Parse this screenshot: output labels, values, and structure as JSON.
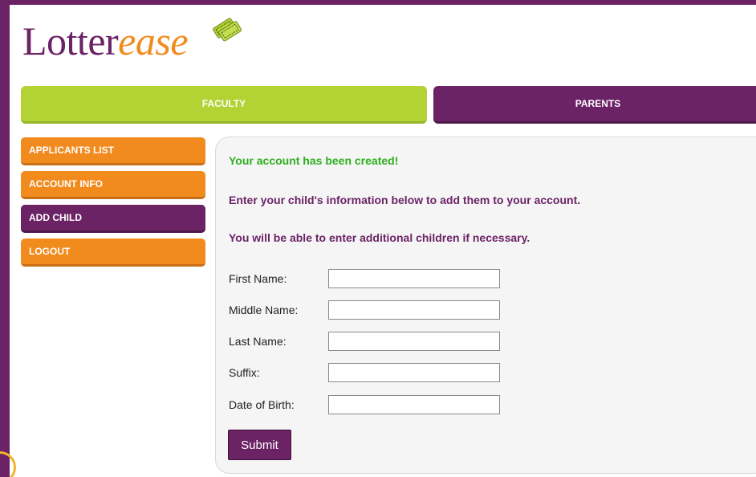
{
  "brand": {
    "name_part1": "Lotter",
    "name_part2": "ease",
    "primary_color": "#6b2366",
    "accent_color": "#f28b1e",
    "tab_green": "#b3d234"
  },
  "tabs": [
    {
      "label": "FACULTY",
      "active": false
    },
    {
      "label": "PARENTS",
      "active": true
    }
  ],
  "sidebar": {
    "items": [
      {
        "label": "APPLICANTS LIST",
        "active": false
      },
      {
        "label": "ACCOUNT INFO",
        "active": false
      },
      {
        "label": "ADD CHILD",
        "active": true
      },
      {
        "label": "LOGOUT",
        "active": false
      }
    ]
  },
  "main": {
    "success_message": "Your account has been created!",
    "instruction": "Enter your child's information below to add them to your account.",
    "note": "You will be able to enter additional children if necessary.",
    "fields": [
      {
        "label": "First Name:",
        "value": ""
      },
      {
        "label": "Middle Name:",
        "value": ""
      },
      {
        "label": "Last Name:",
        "value": ""
      },
      {
        "label": "Suffix:",
        "value": ""
      },
      {
        "label": "Date of Birth:",
        "value": ""
      }
    ],
    "submit_label": "Submit"
  }
}
